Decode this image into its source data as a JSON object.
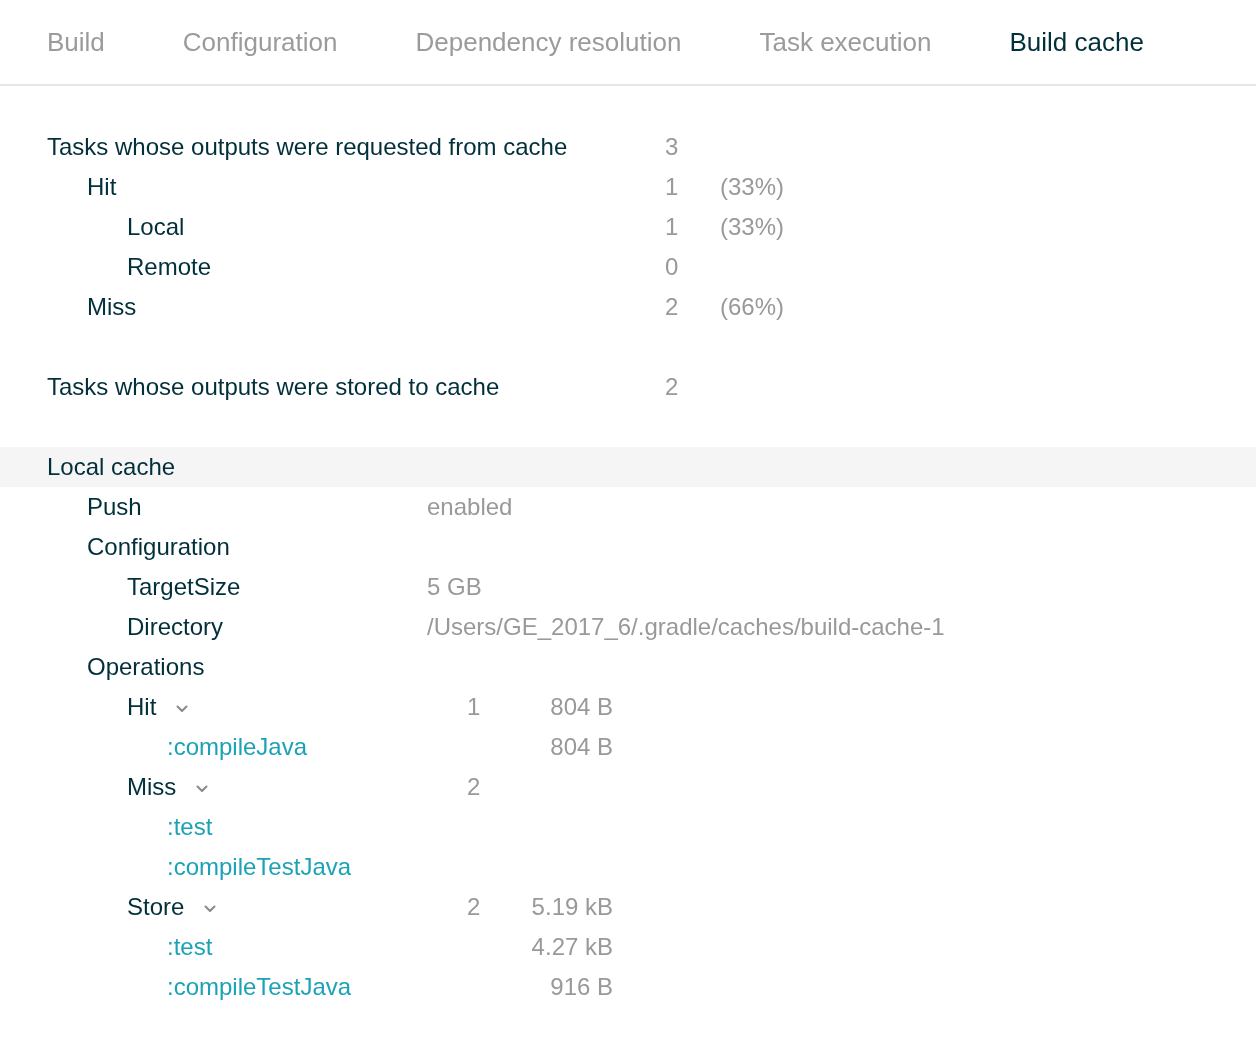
{
  "tabs": [
    {
      "label": "Build",
      "selected": false
    },
    {
      "label": "Configuration",
      "selected": false
    },
    {
      "label": "Dependency resolution",
      "selected": false
    },
    {
      "label": "Task execution",
      "selected": false
    },
    {
      "label": "Build cache",
      "selected": true
    }
  ],
  "requested": {
    "label": "Tasks whose outputs were requested from cache",
    "value": "3",
    "children": [
      {
        "label": "Hit",
        "value": "1",
        "percent": "(33%)",
        "children": [
          {
            "label": "Local",
            "value": "1",
            "percent": "(33%)"
          },
          {
            "label": "Remote",
            "value": "0"
          }
        ]
      },
      {
        "label": "Miss",
        "value": "2",
        "percent": "(66%)"
      }
    ]
  },
  "stored": {
    "label": "Tasks whose outputs were stored to cache",
    "value": "2"
  },
  "local_cache": {
    "title": "Local cache",
    "entries": [
      {
        "label": "Push",
        "value": "enabled"
      },
      {
        "label": "Configuration",
        "children": [
          {
            "label": "TargetSize",
            "value": "5 GB"
          },
          {
            "label": "Directory",
            "value": "/Users/GE_2017_6/.gradle/caches/build-cache-1"
          }
        ]
      }
    ],
    "operations": {
      "label": "Operations",
      "groups": [
        {
          "label": "Hit",
          "count": "1",
          "size": "804 B",
          "expanded": true,
          "tasks": [
            {
              "name": ":compileJava",
              "size": "804 B"
            }
          ]
        },
        {
          "label": "Miss",
          "count": "2",
          "expanded": true,
          "tasks": [
            {
              "name": ":test"
            },
            {
              "name": ":compileTestJava"
            }
          ]
        },
        {
          "label": "Store",
          "count": "2",
          "size": "5.19 kB",
          "expanded": true,
          "tasks": [
            {
              "name": ":test",
              "size": "4.27 kB"
            },
            {
              "name": ":compileTestJava",
              "size": "916 B"
            }
          ]
        }
      ]
    }
  }
}
